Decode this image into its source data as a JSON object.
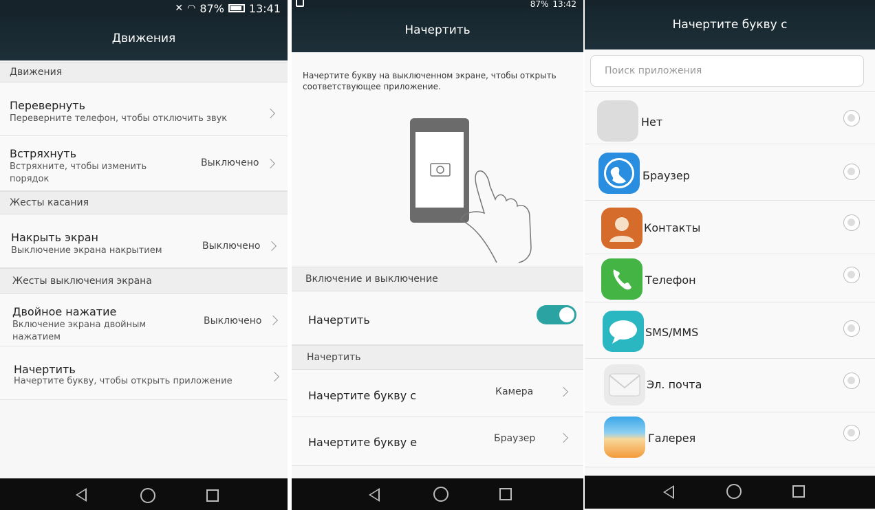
{
  "panel1": {
    "status": {
      "battery": "87%",
      "time": "13:41"
    },
    "title": "Движения",
    "section_motions": "Движения",
    "flip": {
      "title": "Перевернуть",
      "sub": "Переверните телефон, чтобы отключить звук"
    },
    "shake": {
      "title": "Встряхнуть",
      "sub1": "Встряхните, чтобы изменить",
      "sub2": "порядок",
      "value": "Выключено"
    },
    "section_touch": "Жесты касания",
    "cover": {
      "title": "Накрыть экран",
      "sub": "Выключение экрана накрытием",
      "value": "Выключено"
    },
    "section_off": "Жесты выключения экрана",
    "double_tap": {
      "title": "Двойное нажатие",
      "sub1": "Включение экрана двойным",
      "sub2": "нажатием",
      "value": "Выключено"
    },
    "draw": {
      "title": "Начертить",
      "sub": "Начертите букву, чтобы открыть приложение"
    }
  },
  "panel2": {
    "status": {
      "battery": "87%",
      "time": "13:42"
    },
    "title": "Начертить",
    "description": "Начертите букву на выключенном экране, чтобы открыть соответствующее приложение.",
    "section_onoff": "Включение и выключение",
    "toggle_label": "Начертить",
    "toggle_on": true,
    "section_draw": "Начертить",
    "letter_c": {
      "label": "Начертите букву с",
      "value": "Камера"
    },
    "letter_e": {
      "label": "Начертите букву е",
      "value": "Браузер"
    }
  },
  "panel3": {
    "title": "Начертите букву с",
    "search_placeholder": "Поиск приложения",
    "apps": [
      {
        "name": "Нет",
        "icon": "none-icon"
      },
      {
        "name": "Браузер",
        "icon": "browser-icon"
      },
      {
        "name": "Контакты",
        "icon": "contacts-icon"
      },
      {
        "name": "Телефон",
        "icon": "phone-icon"
      },
      {
        "name": "SMS/MMS",
        "icon": "sms-icon"
      },
      {
        "name": "Эл. почта",
        "icon": "email-icon"
      },
      {
        "name": "Галерея",
        "icon": "gallery-icon"
      }
    ]
  },
  "colors": {
    "accent": "#2ba3a3",
    "titlebar": "#17262e",
    "navbar": "#0d0d0d"
  }
}
